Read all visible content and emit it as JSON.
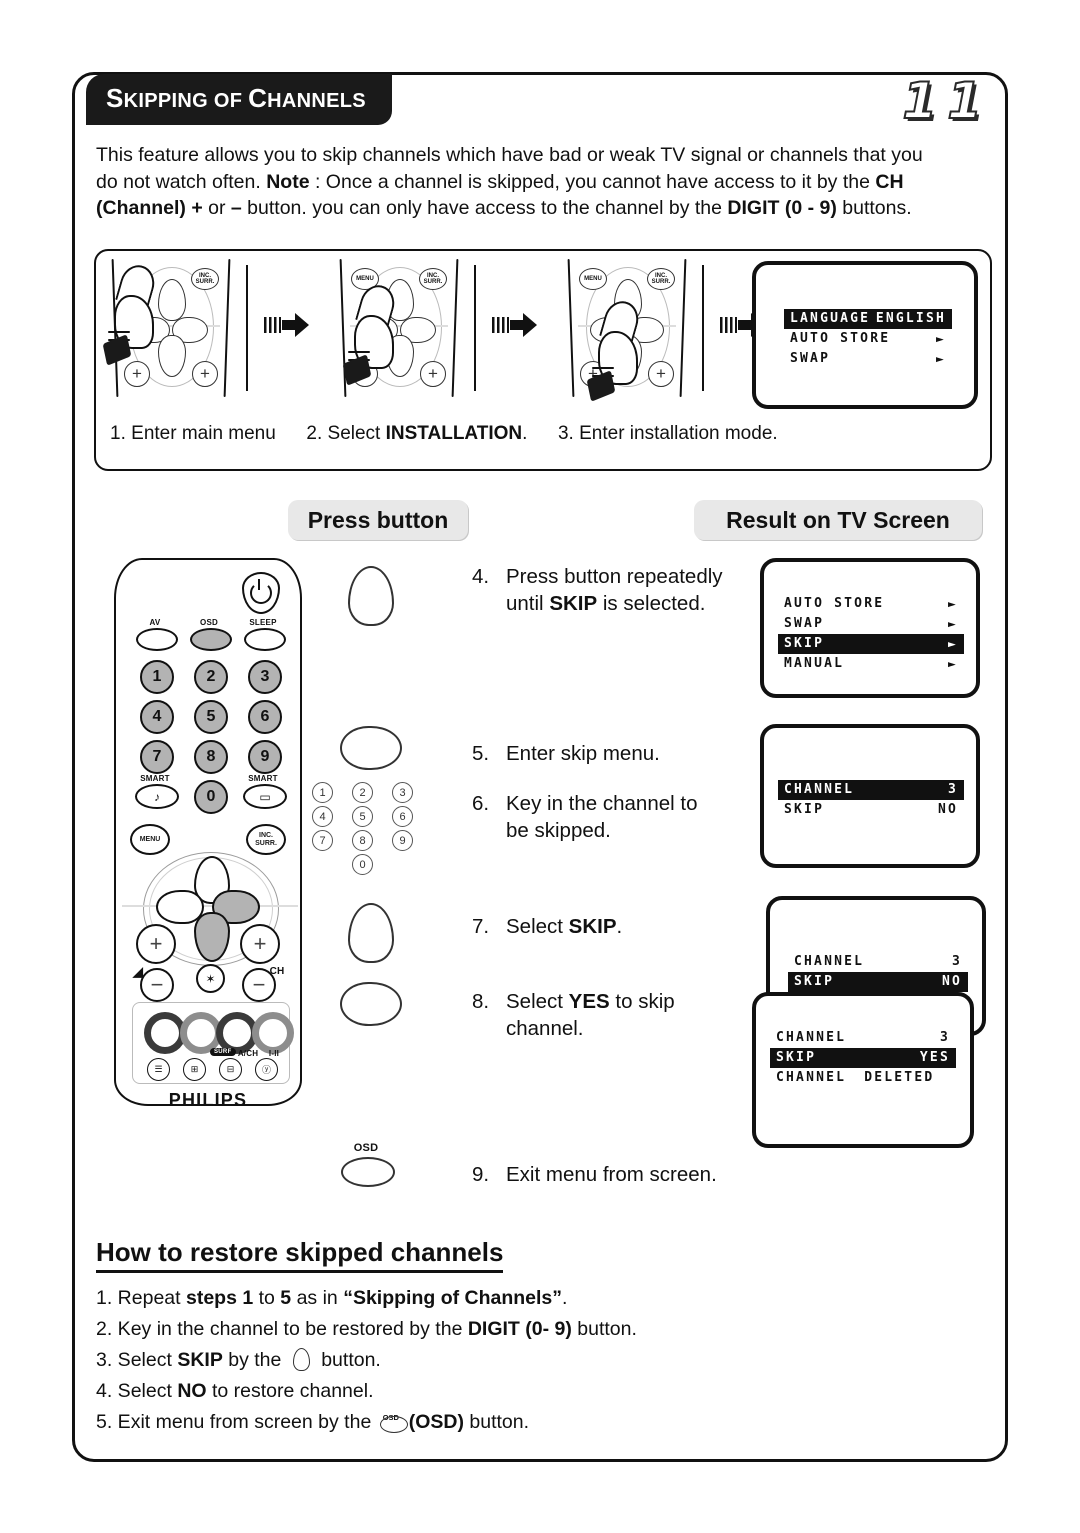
{
  "page": {
    "number": "11",
    "title_first_letter": "S",
    "title_rest_1": "KIPPING OF ",
    "title_c": "C",
    "title_rest_2": "HANNELS"
  },
  "intro": {
    "p1": "This feature allows you to skip channels which have bad or weak TV signal or channels that you do not watch often. ",
    "note_label": "Note",
    "p2": " : Once a channel is skipped, you cannot have access to it by the ",
    "ch_label": "CH (Channel) +",
    "p3": " or ",
    "minus": "–",
    "p4": " button. you can only have access to the channel by the ",
    "digit_label": "DIGIT (0 - 9)",
    "p5": " buttons."
  },
  "top_diagram": {
    "steps": [
      {
        "num": "1.",
        "text": "Enter main menu"
      },
      {
        "num": "2.",
        "text_pre": "Select ",
        "bold": "INSTALLATION",
        "text_post": "."
      },
      {
        "num": "3.",
        "text": "Enter installation mode."
      }
    ],
    "remote_buttons": {
      "menu": "MENU",
      "surr": "INC. SURR."
    },
    "tv_screen": {
      "rows": [
        {
          "label": "LANGUAGE",
          "value": "ENGLISH",
          "highlight": true,
          "arrow": false
        },
        {
          "label": "AUTO STORE",
          "value": "",
          "highlight": false,
          "arrow": true
        },
        {
          "label": "SWAP",
          "value": "",
          "highlight": false,
          "arrow": true
        }
      ]
    }
  },
  "column_headers": {
    "press_button": "Press button",
    "result_on_tv": "Result on TV Screen"
  },
  "remote": {
    "brand": "PHILIPS",
    "top_labels": {
      "av": "AV",
      "osd": "OSD",
      "sleep": "SLEEP"
    },
    "digits": [
      "1",
      "2",
      "3",
      "4",
      "5",
      "6",
      "7",
      "8",
      "9",
      "0"
    ],
    "smart_left": "SMART",
    "smart_right": "SMART",
    "smart_left_glyph": "♪",
    "smart_right_glyph": "▭",
    "menu": "MENU",
    "inc_surr": "INC. SURR.",
    "plus": "+",
    "minus": "−",
    "ch_label": "CH",
    "volume_label": "◢",
    "mute_glyph": "✶",
    "bottom_labels": {
      "surf": "SURF",
      "ach": "A/CH",
      "ii": "I-II"
    },
    "bottom_glyphs": [
      "☰",
      "⊞",
      "⊟",
      "ⓨ"
    ]
  },
  "keypad_glyph": {
    "keys": [
      "1",
      "2",
      "3",
      "4",
      "5",
      "6",
      "7",
      "8",
      "9",
      "0"
    ]
  },
  "steps": [
    {
      "num": "4.",
      "pre": "Press button repeatedly until ",
      "bold": "SKIP",
      "post": " is selected.",
      "icon": "up-button-icon"
    },
    {
      "num": "5.",
      "pre": "Enter skip menu.",
      "bold": "",
      "post": "",
      "icon": "right-button-icon"
    },
    {
      "num": "6.",
      "pre": "Key in the channel  to be skipped.",
      "bold": "",
      "post": "",
      "icon": "digit-keypad-icon"
    },
    {
      "num": "7.",
      "pre": "Select ",
      "bold": "SKIP",
      "post": ".",
      "icon": "up-button-icon"
    },
    {
      "num": "8.",
      "pre": "Select ",
      "bold": "YES",
      "post": " to skip channel.",
      "icon": "right-button-icon"
    },
    {
      "num": "9.",
      "pre": "Exit menu from screen.",
      "bold": "",
      "post": "",
      "icon": "osd-button-icon"
    }
  ],
  "tv_screens": [
    {
      "name": "installation-menu",
      "rows": [
        {
          "label": "AUTO STORE",
          "value": "",
          "highlight": false,
          "arrow": true
        },
        {
          "label": "SWAP",
          "value": "",
          "highlight": false,
          "arrow": true
        },
        {
          "label": "SKIP",
          "value": "",
          "highlight": true,
          "arrow": true
        },
        {
          "label": "MANUAL",
          "value": "",
          "highlight": false,
          "arrow": true
        }
      ]
    },
    {
      "name": "skip-menu-channel-selected",
      "rows": [
        {
          "label": "CHANNEL",
          "value": "3",
          "highlight": true,
          "arrow": false
        },
        {
          "label": "SKIP",
          "value": "NO",
          "highlight": false,
          "arrow": false
        }
      ]
    },
    {
      "name": "skip-menu-skip-no",
      "rows": [
        {
          "label": "CHANNEL",
          "value": "3",
          "highlight": false,
          "arrow": false
        },
        {
          "label": "SKIP",
          "value": "NO",
          "highlight": true,
          "arrow": false
        }
      ]
    },
    {
      "name": "skip-menu-skip-yes",
      "rows": [
        {
          "label": "CHANNEL",
          "value": "3",
          "highlight": false,
          "arrow": false
        },
        {
          "label": "SKIP",
          "value": "YES",
          "highlight": true,
          "arrow": false
        },
        {
          "label": "CHANNEL",
          "value": "DELETED",
          "highlight": false,
          "arrow": false,
          "value_left": true
        }
      ]
    }
  ],
  "restore": {
    "title": "How to restore skipped channels",
    "items": [
      {
        "num": "1.",
        "a": " Repeat ",
        "b1": "steps 1",
        "c": " to ",
        "b2": "5",
        "d": " as in ",
        "b3": "“Skipping of Channels”",
        "e": "."
      },
      {
        "num": "2.",
        "a": " Key in the channel to be restored by the ",
        "b1": "DIGIT (0- 9)",
        "c": " button.",
        "b2": "",
        "d": "",
        "b3": "",
        "e": ""
      },
      {
        "num": "3.",
        "a": " Select ",
        "b1": "SKIP",
        "c": " by the ",
        "b2": "",
        "d": " button.",
        "b3": "",
        "e": ""
      },
      {
        "num": "4.",
        "a": " Select ",
        "b1": "NO",
        "c": " to restore channel.",
        "b2": "",
        "d": "",
        "b3": "",
        "e": ""
      },
      {
        "num": "5.",
        "a": " Exit menu from screen by the ",
        "b1": "",
        "c": "",
        "b2": "",
        "d": "",
        "b3": "(OSD)",
        "e": " button."
      }
    ],
    "osd_caption": "OSD"
  },
  "colors": {
    "ink": "#111111",
    "key_grey": "#b3b3b3",
    "pill_grey": "#e8e8e8"
  }
}
